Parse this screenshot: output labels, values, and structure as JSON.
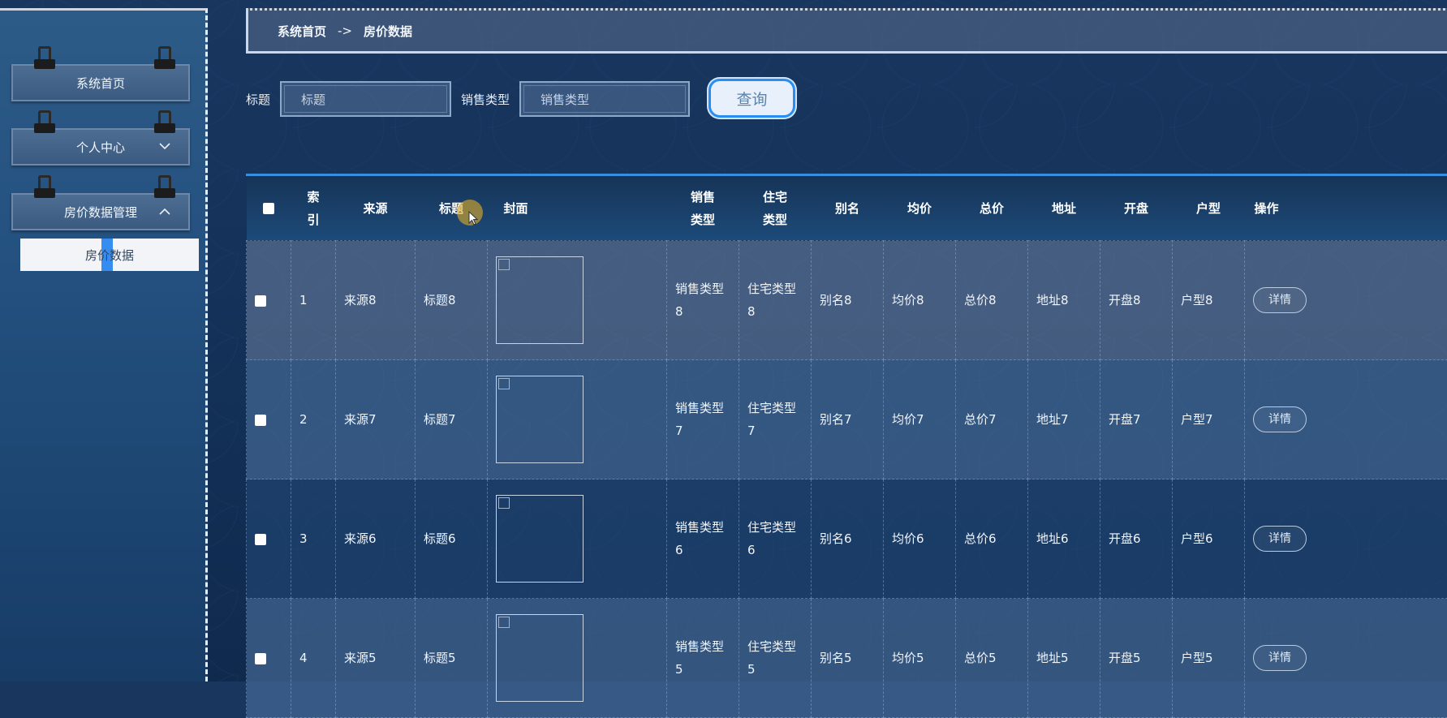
{
  "breadcrumb": {
    "home": "系统首页",
    "sep": "->",
    "current": "房价数据"
  },
  "sidebar": {
    "items": [
      {
        "label": "系统首页",
        "arrow": ""
      },
      {
        "label": "个人中心",
        "arrow": "chevron-down-icon"
      },
      {
        "label": "房价数据管理",
        "arrow": "chevron-up-icon"
      }
    ],
    "sub_items": [
      {
        "label": "房价数据"
      }
    ]
  },
  "search": {
    "title_label": "标题",
    "title_placeholder": "标题",
    "type_label": "销售类型",
    "type_placeholder": "销售类型",
    "query_button": "查询"
  },
  "table": {
    "headers": [
      "索引",
      "来源",
      "标题",
      "封面",
      "销售类型",
      "住宅类型",
      "别名",
      "均价",
      "总价",
      "地址",
      "开盘",
      "户型",
      "操作"
    ],
    "header_lines": {
      "index": [
        "索",
        "引"
      ],
      "sale": [
        "销售",
        "类型"
      ],
      "res": [
        "住宅",
        "类型"
      ]
    },
    "rows": [
      {
        "idx": "1",
        "source": "来源8",
        "title": "标题8",
        "sale": "销售类型8",
        "res": "住宅类型8",
        "alias": "别名8",
        "avg": "均价8",
        "total": "总价8",
        "addr": "地址8",
        "open": "开盘8",
        "layout": "户型8",
        "action": "详情"
      },
      {
        "idx": "2",
        "source": "来源7",
        "title": "标题7",
        "sale": "销售类型7",
        "res": "住宅类型7",
        "alias": "别名7",
        "avg": "均价7",
        "total": "总价7",
        "addr": "地址7",
        "open": "开盘7",
        "layout": "户型7",
        "action": "详情"
      },
      {
        "idx": "3",
        "source": "来源6",
        "title": "标题6",
        "sale": "销售类型6",
        "res": "住宅类型6",
        "alias": "别名6",
        "avg": "均价6",
        "total": "总价6",
        "addr": "地址6",
        "open": "开盘6",
        "layout": "户型6",
        "action": "详情"
      },
      {
        "idx": "4",
        "source": "来源5",
        "title": "标题5",
        "sale": "销售类型5",
        "res": "住宅类型5",
        "alias": "别名5",
        "avg": "均价5",
        "total": "总价5",
        "addr": "地址5",
        "open": "开盘5",
        "layout": "户型5",
        "action": "详情"
      }
    ]
  },
  "colors": {
    "accent": "#2a8df2",
    "table_border": "#3a8ee0"
  }
}
